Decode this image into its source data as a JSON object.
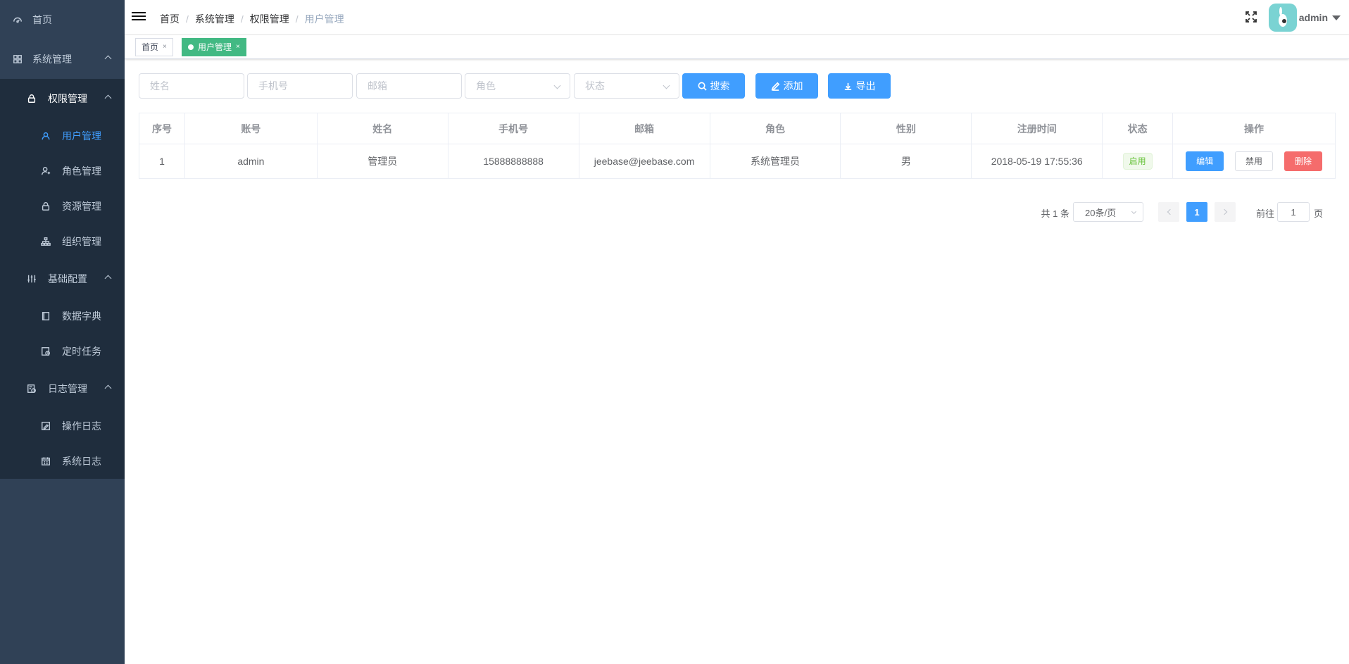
{
  "sidebar": {
    "items": [
      {
        "label": "首页",
        "icon": "dashboard-icon"
      },
      {
        "label": "系统管理",
        "icon": "grid-icon"
      },
      {
        "label": "权限管理",
        "icon": "lock-icon"
      },
      {
        "label": "用户管理",
        "icon": "user-icon",
        "active": true
      },
      {
        "label": "角色管理",
        "icon": "user-role-icon"
      },
      {
        "label": "资源管理",
        "icon": "lock-icon"
      },
      {
        "label": "组织管理",
        "icon": "org-tree-icon"
      },
      {
        "label": "基础配置",
        "icon": "sliders-icon"
      },
      {
        "label": "数据字典",
        "icon": "book-icon"
      },
      {
        "label": "定时任务",
        "icon": "clock-doc-icon"
      },
      {
        "label": "日志管理",
        "icon": "log-icon"
      },
      {
        "label": "操作日志",
        "icon": "edit-log-icon"
      },
      {
        "label": "系统日志",
        "icon": "calendar-icon"
      }
    ]
  },
  "header": {
    "breadcrumb": [
      "首页",
      "系统管理",
      "权限管理",
      "用户管理"
    ],
    "username": "admin"
  },
  "tags": [
    {
      "label": "首页",
      "active": false
    },
    {
      "label": "用户管理",
      "active": true
    }
  ],
  "filters": {
    "name_placeholder": "姓名",
    "phone_placeholder": "手机号",
    "email_placeholder": "邮箱",
    "role_placeholder": "角色",
    "status_placeholder": "状态",
    "search_label": "搜索",
    "add_label": "添加",
    "export_label": "导出"
  },
  "table": {
    "columns": [
      "序号",
      "账号",
      "姓名",
      "手机号",
      "邮箱",
      "角色",
      "性别",
      "注册时间",
      "状态",
      "操作"
    ],
    "rows": [
      {
        "index": "1",
        "account": "admin",
        "name": "管理员",
        "phone": "15888888888",
        "email": "jeebase@jeebase.com",
        "role": "系统管理员",
        "gender": "男",
        "registered": "2018-05-19 17:55:36",
        "status": "启用",
        "actions": {
          "edit": "编辑",
          "disable": "禁用",
          "delete": "删除"
        }
      }
    ]
  },
  "pagination": {
    "total_text": "共 1 条",
    "page_size": "20条/页",
    "current_page": "1",
    "goto_prefix": "前往",
    "goto_value": "1",
    "goto_suffix": "页"
  },
  "colors": {
    "sidebar_bg": "#304156",
    "primary": "#409eff",
    "active_tag": "#42b983",
    "danger": "#f56c6c",
    "success": "#67c23a"
  }
}
